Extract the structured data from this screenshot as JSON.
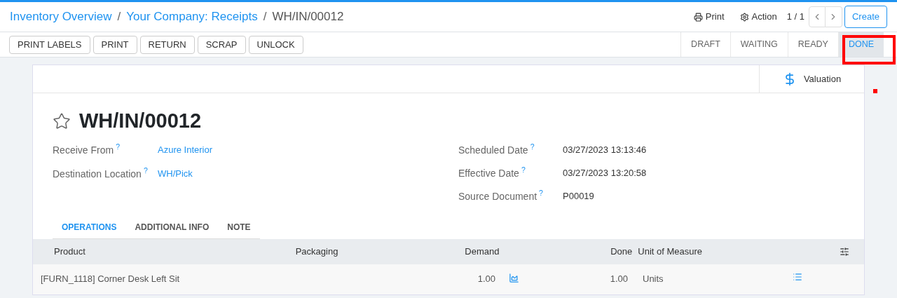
{
  "breadcrumbs": [
    {
      "label": "Inventory Overview",
      "link": true
    },
    {
      "separator": "/",
      "label": "Your Company: Receipts",
      "link": true
    },
    {
      "separator": "/",
      "label": "WH/IN/00012",
      "link": false
    }
  ],
  "top_actions": {
    "print": "Print",
    "action": "Action",
    "pager": "1 / 1",
    "create": "Create"
  },
  "action_buttons": [
    "PRINT LABELS",
    "PRINT",
    "RETURN",
    "SCRAP",
    "UNLOCK"
  ],
  "statuses": [
    {
      "label": "DRAFT",
      "selected": false
    },
    {
      "label": "WAITING",
      "selected": false
    },
    {
      "label": "READY",
      "selected": false
    },
    {
      "label": "DONE",
      "selected": true
    }
  ],
  "smart_button": "Valuation",
  "record": {
    "title": "WH/IN/00012",
    "starred": false
  },
  "left_fields": [
    {
      "label": "Receive From",
      "help": "?",
      "value": "Azure Interior",
      "link": true
    },
    {
      "label": "Destination Location",
      "help": "?",
      "value": "WH/Pick",
      "link": true
    }
  ],
  "right_fields": [
    {
      "label": "Scheduled Date",
      "help": "?",
      "value": "03/27/2023 13:13:46"
    },
    {
      "label": "Effective Date",
      "help": "?",
      "value": "03/27/2023 13:20:58"
    },
    {
      "label": "Source Document",
      "help": "?",
      "value": "P00019"
    }
  ],
  "tabs": [
    {
      "label": "OPERATIONS",
      "selected": true
    },
    {
      "label": "ADDITIONAL INFO",
      "selected": false
    },
    {
      "label": "NOTE",
      "selected": false
    }
  ],
  "table": {
    "columns": [
      "Product",
      "Packaging",
      "Demand",
      "Done",
      "Unit of Measure"
    ],
    "rows": [
      {
        "product": "[FURN_1118] Corner Desk Left Sit",
        "packaging": "",
        "demand": "1.00",
        "done": "1.00",
        "uom": "Units"
      }
    ]
  }
}
